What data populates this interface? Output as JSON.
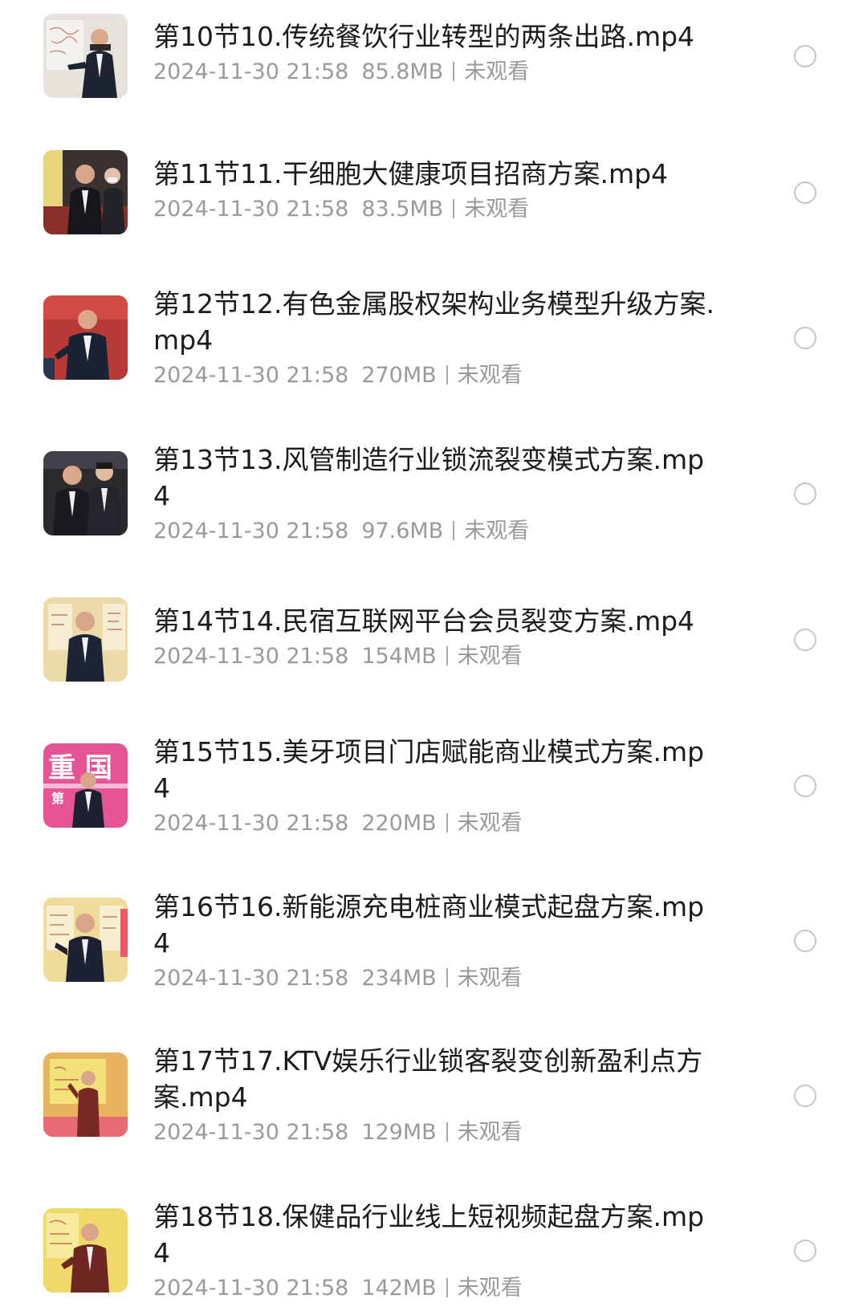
{
  "files": [
    {
      "name": "第10节10.传统餐饮行业转型的两条出路.mp4",
      "date": "2024-11-30 21:58",
      "size": "85.8MB",
      "status": "未观看",
      "thumb_bg": "#e7e3dc"
    },
    {
      "name": "第11节11.干细胞大健康项目招商方案.mp4",
      "date": "2024-11-30 21:58",
      "size": "83.5MB",
      "status": "未观看",
      "thumb_bg": "#3a3230"
    },
    {
      "name": "第12节12.有色金属股权架构业务模型升级方案.mp4",
      "date": "2024-11-30 21:58",
      "size": "270MB",
      "status": "未观看",
      "thumb_bg": "#b83a36"
    },
    {
      "name": "第13节13.风管制造行业锁流裂变模式方案.mp4",
      "date": "2024-11-30 21:58",
      "size": "97.6MB",
      "status": "未观看",
      "thumb_bg": "#2c2a2c"
    },
    {
      "name": "第14节14.民宿互联网平台会员裂变方案.mp4",
      "date": "2024-11-30 21:58",
      "size": "154MB",
      "status": "未观看",
      "thumb_bg": "#ecd9a8"
    },
    {
      "name": "第15节15.美牙项目门店赋能商业模式方案.mp4",
      "date": "2024-11-30 21:58",
      "size": "220MB",
      "status": "未观看",
      "thumb_bg": "#e65496",
      "thumb_text": "重 国",
      "thumb_text2": "第"
    },
    {
      "name": "第16节16.新能源充电桩商业模式起盘方案.mp4",
      "date": "2024-11-30 21:58",
      "size": "234MB",
      "status": "未观看",
      "thumb_bg": "#efdc9a"
    },
    {
      "name": "第17节17.KTV娱乐行业锁客裂变创新盈利点方案.mp4",
      "date": "2024-11-30 21:58",
      "size": "129MB",
      "status": "未观看",
      "thumb_bg": "#e8b35e"
    },
    {
      "name": "第18节18.保健品行业线上短视频起盘方案.mp4",
      "date": "2024-11-30 21:58",
      "size": "142MB",
      "status": "未观看",
      "thumb_bg": "#f1d86a"
    }
  ],
  "colors": {
    "title_text": "#1b1b1b",
    "meta_text": "#9a9a9a",
    "radio_border": "#c6c6c6"
  },
  "icons": {
    "select": "radio-circle-icon",
    "thumbnail": "video-thumbnail-icon"
  }
}
